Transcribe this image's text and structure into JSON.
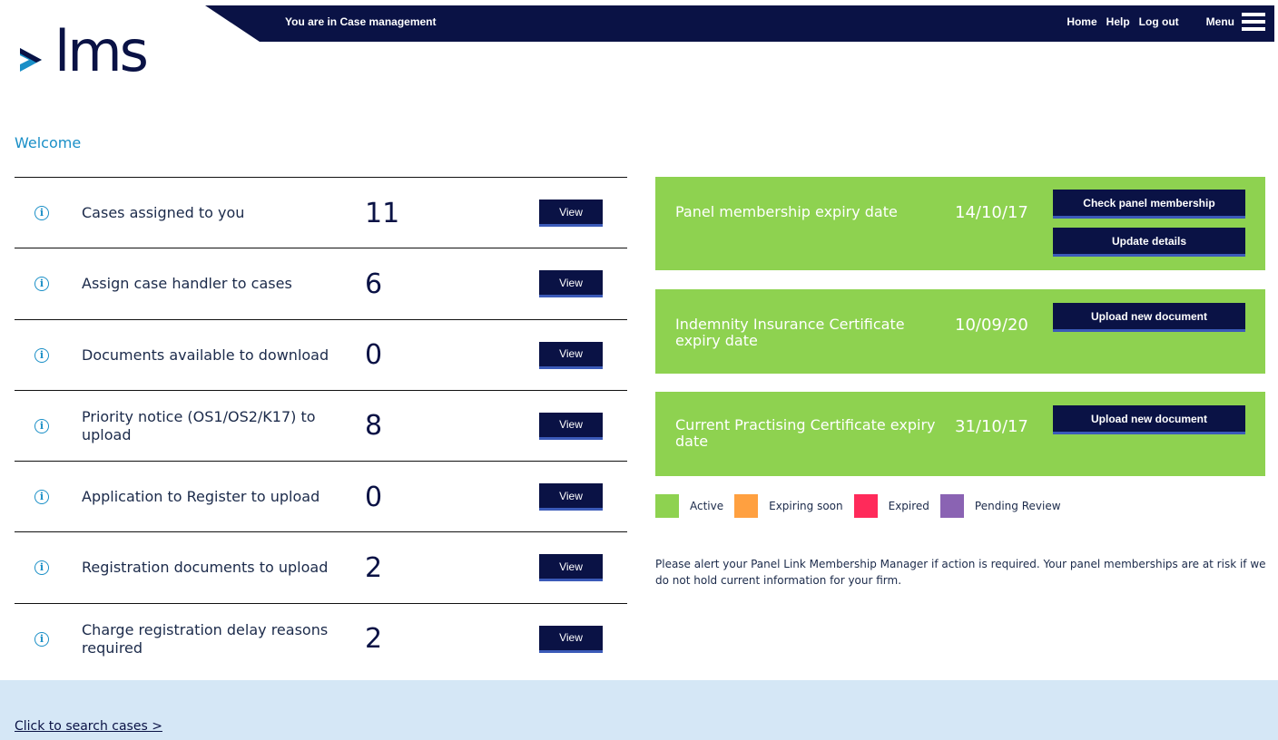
{
  "header": {
    "location": "You are in Case management",
    "nav": [
      "Home",
      "Help",
      "Log out"
    ],
    "menu_label": "Menu",
    "logo_text": "lms"
  },
  "welcome": "Welcome",
  "tasks": [
    {
      "label": "Cases assigned to you",
      "count": "11",
      "button": "View"
    },
    {
      "label": "Assign case handler to cases",
      "count": "6",
      "button": "View"
    },
    {
      "label": "Documents available to download",
      "count": "0",
      "button": "View"
    },
    {
      "label": "Priority notice (OS1/OS2/K17) to upload",
      "count": "8",
      "button": "View"
    },
    {
      "label": "Application to Register to upload",
      "count": "0",
      "button": "View"
    },
    {
      "label": "Registration documents to upload",
      "count": "2",
      "button": "View"
    },
    {
      "label": "Charge registration delay reasons required",
      "count": "2",
      "button": "View"
    }
  ],
  "cards": [
    {
      "title": "Panel membership expiry date",
      "date": "14/10/17",
      "buttons": [
        "Check panel membership",
        "Update details"
      ]
    },
    {
      "title": "Indemnity Insurance Certificate expiry date",
      "date": "10/09/20",
      "buttons": [
        "Upload new document"
      ]
    },
    {
      "title": "Current Practising Certificate expiry date",
      "date": "31/10/17",
      "buttons": [
        "Upload new document"
      ]
    }
  ],
  "legend": [
    {
      "label": "Active",
      "color": "#8ed250"
    },
    {
      "label": "Expiring soon",
      "color": "#ffa040"
    },
    {
      "label": "Expired",
      "color": "#ff2a5a"
    },
    {
      "label": "Pending Review",
      "color": "#8a63b3"
    }
  ],
  "alert_text": "Please alert your Panel Link Membership Manager if action is required. Your panel memberships are at risk if we do not hold current information for your firm.",
  "footer": {
    "search_link": "Click to search cases >"
  },
  "colors": {
    "navy": "#0a1245",
    "accent_blue": "#1a8fc7",
    "card_green": "#8ed250",
    "footer_bg": "#d5e7f6"
  }
}
